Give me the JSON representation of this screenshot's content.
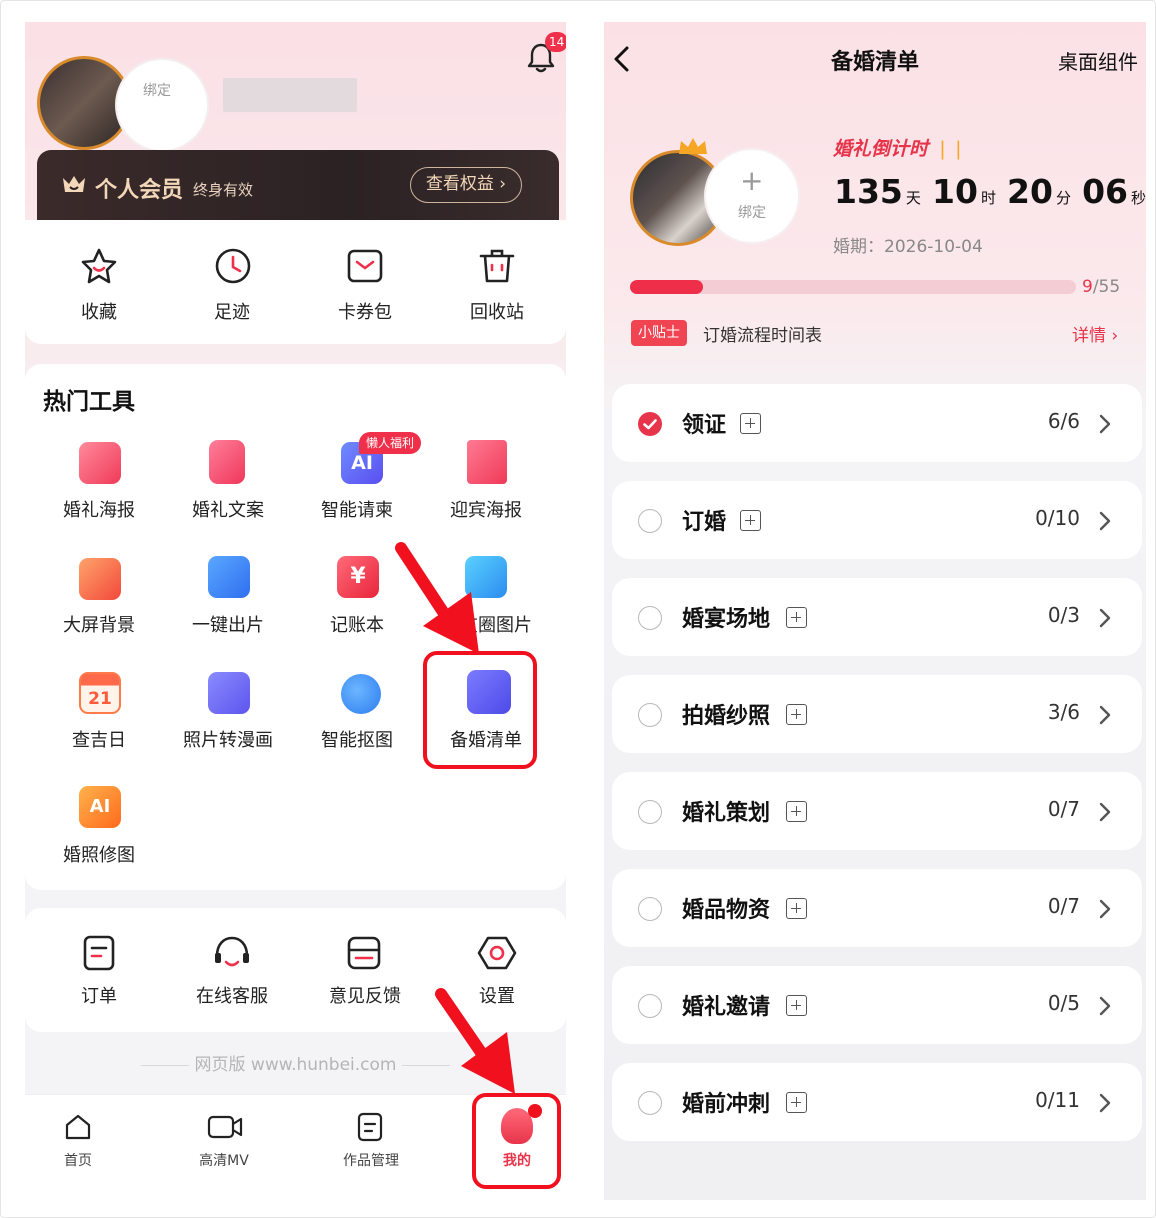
{
  "left": {
    "bell_badge": "14",
    "bind_label": "绑定",
    "vip": {
      "title": "个人会员",
      "subtitle": "终身有效",
      "button": "查看权益"
    },
    "quick": [
      {
        "label": "收藏",
        "icon": "star-icon"
      },
      {
        "label": "足迹",
        "icon": "clock-icon"
      },
      {
        "label": "卡券包",
        "icon": "coupon-icon"
      },
      {
        "label": "回收站",
        "icon": "trash-icon"
      }
    ],
    "hot_title": "热门工具",
    "tools": [
      {
        "label": "婚礼海报",
        "icon": "poster-icon"
      },
      {
        "label": "婚礼文案",
        "icon": "copywriting-icon"
      },
      {
        "label": "智能请柬",
        "icon": "ai-invitation-icon",
        "badge": "懒人福利"
      },
      {
        "label": "迎宾海报",
        "icon": "welcome-poster-icon"
      },
      {
        "label": "大屏背景",
        "icon": "screen-background-icon"
      },
      {
        "label": "一键出片",
        "icon": "quick-film-icon"
      },
      {
        "label": "记账本",
        "icon": "ledger-icon"
      },
      {
        "label": "友圈图片",
        "icon": "moments-image-icon"
      },
      {
        "label": "查吉日",
        "icon": "calendar-icon",
        "day": "21"
      },
      {
        "label": "照片转漫画",
        "icon": "photo-comic-icon"
      },
      {
        "label": "智能抠图",
        "icon": "cutout-icon"
      },
      {
        "label": "备婚清单",
        "icon": "checklist-icon"
      },
      {
        "label": "婚照修图",
        "icon": "ai-retouch-icon"
      }
    ],
    "services": [
      {
        "label": "订单",
        "icon": "order-icon"
      },
      {
        "label": "在线客服",
        "icon": "headset-icon"
      },
      {
        "label": "意见反馈",
        "icon": "feedback-icon"
      },
      {
        "label": "设置",
        "icon": "settings-icon"
      }
    ],
    "footer": "网页版 www.hunbei.com",
    "tabs": [
      {
        "label": "首页",
        "icon": "home-icon"
      },
      {
        "label": "高清MV",
        "icon": "video-icon"
      },
      {
        "label": "作品管理",
        "icon": "works-icon"
      },
      {
        "label": "我的",
        "icon": "profile-icon",
        "active": true
      }
    ]
  },
  "right": {
    "title": "备婚清单",
    "widget": "桌面组件",
    "bind_label": "绑定",
    "countdown_label": "婚礼倒计时",
    "countdown": {
      "days": "135",
      "days_unit": "天",
      "hours": "10",
      "hours_unit": "时",
      "minutes": "20",
      "minutes_unit": "分",
      "seconds": "06",
      "seconds_unit": "秒"
    },
    "wedding_date_label": "婚期：",
    "wedding_date": "2026-10-04",
    "progress": {
      "done": "9",
      "total": "/55",
      "fraction": 0.164
    },
    "tip_tag": "小贴士",
    "tip_text": "订婚流程时间表",
    "tip_more": "详情",
    "items": [
      {
        "title": "领证",
        "count": "6/6",
        "done": true
      },
      {
        "title": "订婚",
        "count": "0/10",
        "done": false
      },
      {
        "title": "婚宴场地",
        "count": "0/3",
        "done": false
      },
      {
        "title": "拍婚纱照",
        "count": "3/6",
        "done": false
      },
      {
        "title": "婚礼策划",
        "count": "0/7",
        "done": false
      },
      {
        "title": "婚品物资",
        "count": "0/7",
        "done": false
      },
      {
        "title": "婚礼邀请",
        "count": "0/5",
        "done": false
      },
      {
        "title": "婚前冲刺",
        "count": "0/11",
        "done": false
      }
    ]
  },
  "colors": {
    "accent": "#e8344a",
    "highlight": "#f0101e",
    "vip_bg": "#2b2224",
    "vip_text": "#f3d7b9"
  }
}
